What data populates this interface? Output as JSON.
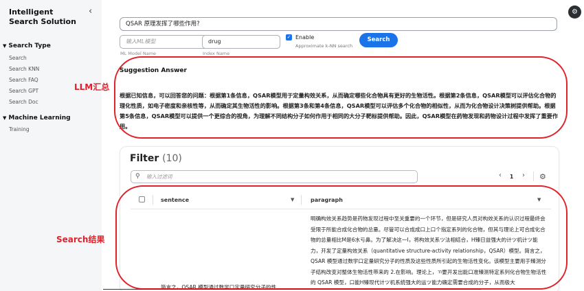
{
  "sidebar": {
    "brand": "Intelligent Search Solution",
    "collapse_icon": "chevron-left",
    "sections": [
      {
        "title": "Search Type",
        "items": [
          "Search",
          "Search KNN",
          "Search FAQ",
          "Search GPT",
          "Search Doc"
        ]
      },
      {
        "title": "Machine Learning",
        "items": [
          "Training"
        ]
      }
    ]
  },
  "search": {
    "query": "QSAR 原理发挥了哪些作用?",
    "model_placeholder": "输入ML模型",
    "model_label": "ML Model Name",
    "index_value": "drug",
    "index_label": "Index Name",
    "enable_label": "Enable",
    "enable_checked": true,
    "enable_sub": "Approximate k-NN search",
    "button": "Search"
  },
  "suggestion": {
    "title": "Suggestion Answer",
    "body": "根据已知信息，可以回答您的问题：根据第1条信息，QSAR模型用于定量构效关系，从而确定哪些化合物具有更好的生物活性。根据第2条信息，QSAR模型可以评估化合物的理化性质，如电子密度和亲核性等，从而确定其生物活性的影响。根据第3条和第4条信息，QSAR模型可以评估多个化合物的相似性，从而为化合物设计决策树提供帮助。根据第5条信息，QSAR模型可以提供一个更综合的视角，为理解不同结构分子如何作用于相同的大分子靶标提供帮助。因此，QSAR模型在药物发现和药物设计过程中发挥了重要作用。"
  },
  "annotations": {
    "llm": "LLM汇总",
    "search": "Search结果"
  },
  "filter": {
    "title": "Filter",
    "count": "(10)",
    "placeholder": "输入过滤词",
    "page": "1",
    "columns": [
      "sentence",
      "paragraph"
    ],
    "row": {
      "paragraph": "明确构效关系趋势是药物发现过程中至关重要的一个环节，但是研究人员对构效关系的认识过程最终会受限于所能合成化合物的总量。尽管可以合成成口上口个指定系列的化合物，但其与理论上可合成化合物的总量相比M是6水亏鼻。为了解决这一I，将构效关系ツ法相结合，H臻日益强大的计ツ机计ツ能力，开发了定量构效关系（quantitative structure-activity relationship，QSAR）模型。简言之，QSAR 模型通过数学口定量研究分子的性质及这些性质所引起的生物活性变化。该模型主要用于臻测分子结构改变对整体生物活性带来的 2.在影响。理论上，ㄲ要开发出能口准臻测特定系列化合物生物活性的 QSAR 模型，口能H臻现代计ツ机系统强大的运ツ能力确定需要合成的分子，从而极大",
      "sentence": "简言之，QSAR 模型通过数学口定量研究分子的性"
    }
  }
}
